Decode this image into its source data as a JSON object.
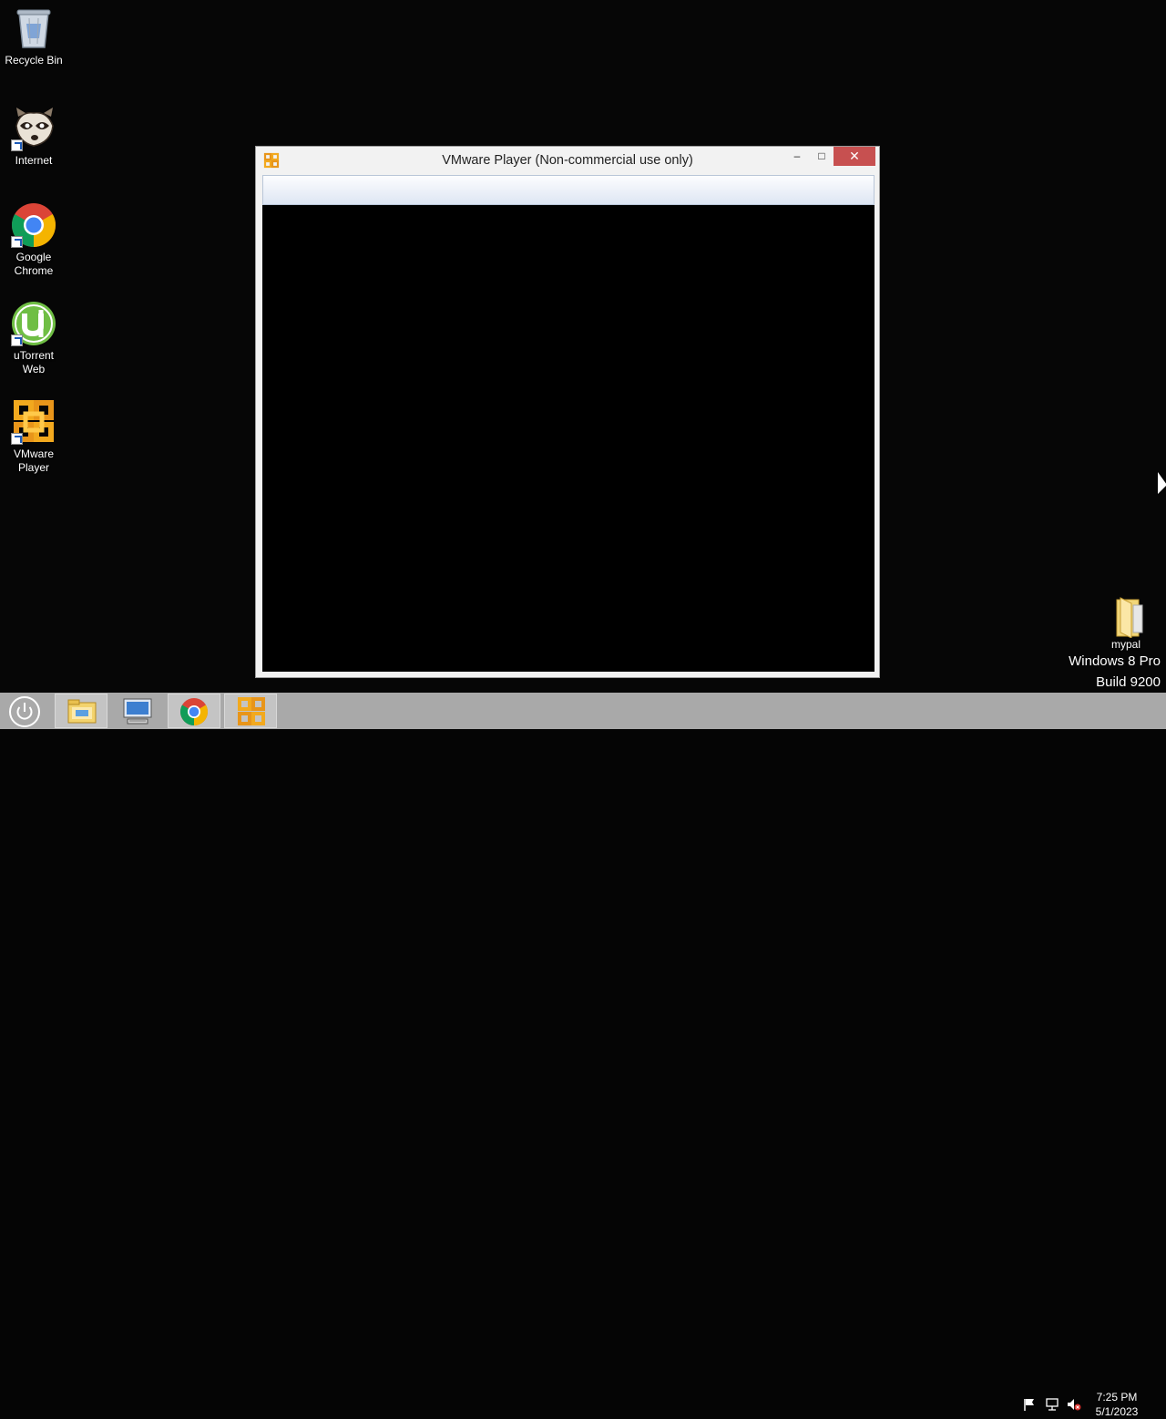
{
  "desktop": {
    "icons": [
      {
        "label": "Recycle Bin",
        "icon": "recycle-bin-icon"
      },
      {
        "label": "Internet",
        "icon": "raccoon-icon"
      },
      {
        "label": "Google\nChrome",
        "icon": "chrome-icon"
      },
      {
        "label": "uTorrent\nWeb",
        "icon": "utorrent-icon"
      },
      {
        "label": "VMware\nPlayer",
        "icon": "vmware-icon"
      },
      {
        "label": "mypal",
        "icon": "folder-icon"
      }
    ],
    "os_edition": "Windows 8 Pro",
    "os_build": "Build 9200"
  },
  "window": {
    "title": "VMware Player (Non-commercial use only)",
    "minimize_glyph": "–",
    "maximize_glyph": "□",
    "close_glyph": "✕"
  },
  "taskbar": {
    "items": [
      {
        "icon": "power-icon",
        "active": false
      },
      {
        "icon": "file-explorer-icon",
        "active": true
      },
      {
        "icon": "remote-desktop-icon",
        "active": false
      },
      {
        "icon": "chrome-icon",
        "active": true
      },
      {
        "icon": "vmware-icon",
        "active": true
      }
    ],
    "tray_icons": [
      "action-center-flag-icon",
      "network-icon",
      "volume-muted-icon"
    ],
    "clock_time": "7:25 PM",
    "clock_date": "5/1/2023"
  },
  "colors": {
    "desktop_bg": "#060606",
    "taskbar_bg": "#a9a9a9",
    "close_button": "#c75050",
    "chrome_red": "#db4437",
    "chrome_green": "#0f9d58",
    "chrome_yellow": "#f4b400",
    "chrome_blue": "#4285f4",
    "utorrent_green": "#6fbe44",
    "vmware_orange": "#f2a91e"
  }
}
